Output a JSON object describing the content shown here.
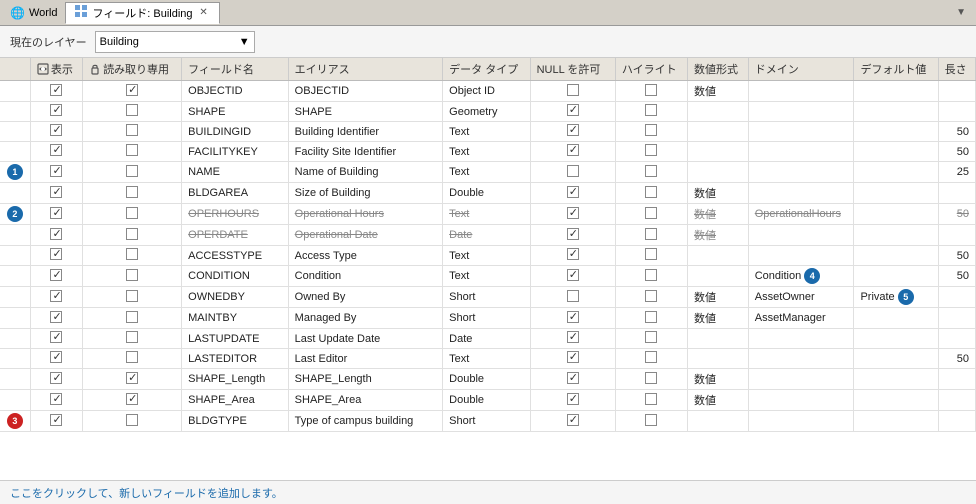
{
  "tabs": {
    "world": {
      "label": "World",
      "active": false
    },
    "fields": {
      "label": "フィールド: Building",
      "active": true
    }
  },
  "layer_bar": {
    "label": "現在のレイヤー",
    "value": "Building"
  },
  "table": {
    "columns": [
      {
        "id": "show",
        "label": "表示",
        "icon": "eye"
      },
      {
        "id": "readonly",
        "label": "読み取り専用",
        "icon": "lock"
      },
      {
        "id": "fieldname",
        "label": "フィールド名"
      },
      {
        "id": "alias",
        "label": "エイリアス"
      },
      {
        "id": "datatype",
        "label": "データ タイプ"
      },
      {
        "id": "allownull",
        "label": "NULL を許可"
      },
      {
        "id": "highlight",
        "label": "ハイライト"
      },
      {
        "id": "numformat",
        "label": "数値形式"
      },
      {
        "id": "domain",
        "label": "ドメイン"
      },
      {
        "id": "default",
        "label": "デフォルト値"
      },
      {
        "id": "length",
        "label": "長さ"
      }
    ],
    "rows": [
      {
        "bullet": "",
        "show": true,
        "readonly": true,
        "fieldname": "OBJECTID",
        "alias": "OBJECTID",
        "datatype": "Object ID",
        "allownull": false,
        "highlight": false,
        "numformat": "数値",
        "domain": "",
        "default": "",
        "length": "",
        "strikethrough": false
      },
      {
        "bullet": "",
        "show": true,
        "readonly": false,
        "fieldname": "SHAPE",
        "alias": "SHAPE",
        "datatype": "Geometry",
        "allownull": true,
        "highlight": false,
        "numformat": "",
        "domain": "",
        "default": "",
        "length": "",
        "strikethrough": false
      },
      {
        "bullet": "",
        "show": true,
        "readonly": false,
        "fieldname": "BUILDINGID",
        "alias": "Building Identifier",
        "datatype": "Text",
        "allownull": true,
        "highlight": false,
        "numformat": "",
        "domain": "",
        "default": "",
        "length": "50",
        "strikethrough": false
      },
      {
        "bullet": "",
        "show": true,
        "readonly": false,
        "fieldname": "FACILITYKEY",
        "alias": "Facility Site Identifier",
        "datatype": "Text",
        "allownull": true,
        "highlight": false,
        "numformat": "",
        "domain": "",
        "default": "",
        "length": "50",
        "strikethrough": false
      },
      {
        "bullet": "1",
        "show": true,
        "readonly": false,
        "fieldname": "NAME",
        "alias": "Name of Building",
        "datatype": "Text",
        "allownull": false,
        "highlight": false,
        "numformat": "",
        "domain": "",
        "default": "",
        "length": "25",
        "strikethrough": false
      },
      {
        "bullet": "",
        "show": true,
        "readonly": false,
        "fieldname": "BLDGAREA",
        "alias": "Size of Building",
        "datatype": "Double",
        "allownull": true,
        "highlight": false,
        "numformat": "数値",
        "domain": "",
        "default": "",
        "length": "",
        "strikethrough": false
      },
      {
        "bullet": "2",
        "show": true,
        "readonly": false,
        "fieldname": "OPERHOURS",
        "alias": "Operational Hours",
        "datatype": "Text",
        "allownull": true,
        "highlight": false,
        "numformat": "数値",
        "domain": "OperationalHours",
        "default": "",
        "length": "50",
        "strikethrough": true
      },
      {
        "bullet": "",
        "show": true,
        "readonly": false,
        "fieldname": "OPERDATE",
        "alias": "Operational Date",
        "datatype": "Date",
        "allownull": true,
        "highlight": false,
        "numformat": "数値",
        "domain": "",
        "default": "",
        "length": "",
        "strikethrough": true
      },
      {
        "bullet": "",
        "show": true,
        "readonly": false,
        "fieldname": "ACCESSTYPE",
        "alias": "Access Type",
        "datatype": "Text",
        "allownull": true,
        "highlight": false,
        "numformat": "",
        "domain": "",
        "default": "",
        "length": "50",
        "strikethrough": false
      },
      {
        "bullet": "",
        "show": true,
        "readonly": false,
        "fieldname": "CONDITION",
        "alias": "Condition",
        "datatype": "Text",
        "allownull": true,
        "highlight": false,
        "numformat": "",
        "domain": "Condition",
        "default": "",
        "length": "50",
        "strikethrough": false
      },
      {
        "bullet": "",
        "show": true,
        "readonly": false,
        "fieldname": "OWNEDBY",
        "alias": "Owned By",
        "datatype": "Short",
        "allownull": false,
        "highlight": false,
        "numformat": "数値",
        "domain": "AssetOwner",
        "default": "Private",
        "length": "",
        "strikethrough": false
      },
      {
        "bullet": "",
        "show": true,
        "readonly": false,
        "fieldname": "MAINTBY",
        "alias": "Managed By",
        "datatype": "Short",
        "allownull": true,
        "highlight": false,
        "numformat": "数値",
        "domain": "AssetManager",
        "default": "",
        "length": "",
        "strikethrough": false
      },
      {
        "bullet": "",
        "show": true,
        "readonly": false,
        "fieldname": "LASTUPDATE",
        "alias": "Last Update Date",
        "datatype": "Date",
        "allownull": true,
        "highlight": false,
        "numformat": "",
        "domain": "",
        "default": "",
        "length": "",
        "strikethrough": false
      },
      {
        "bullet": "",
        "show": true,
        "readonly": false,
        "fieldname": "LASTEDITOR",
        "alias": "Last Editor",
        "datatype": "Text",
        "allownull": true,
        "highlight": false,
        "numformat": "",
        "domain": "",
        "default": "",
        "length": "50",
        "strikethrough": false
      },
      {
        "bullet": "",
        "show": true,
        "readonly": true,
        "fieldname": "SHAPE_Length",
        "alias": "SHAPE_Length",
        "datatype": "Double",
        "allownull": true,
        "highlight": false,
        "numformat": "数値",
        "domain": "",
        "default": "",
        "length": "",
        "strikethrough": false
      },
      {
        "bullet": "",
        "show": true,
        "readonly": true,
        "fieldname": "SHAPE_Area",
        "alias": "SHAPE_Area",
        "datatype": "Double",
        "allownull": true,
        "highlight": false,
        "numformat": "数値",
        "domain": "",
        "default": "",
        "length": "",
        "strikethrough": false
      },
      {
        "bullet": "3",
        "show": true,
        "readonly": false,
        "fieldname": "BLDGTYPE",
        "alias": "Type of campus building",
        "datatype": "Short",
        "allownull": true,
        "highlight": false,
        "numformat": "",
        "domain": "",
        "default": "",
        "length": "",
        "strikethrough": false
      }
    ]
  },
  "footer": {
    "label": "ここをクリックして、新しいフィールドを追加します。"
  },
  "bullets": {
    "1": "blue",
    "2": "blue",
    "3": "red",
    "4": "blue",
    "5": "blue"
  },
  "badge4": "4",
  "badge5": "5",
  "condition_domain_note": "Condition",
  "private_note": "Private"
}
